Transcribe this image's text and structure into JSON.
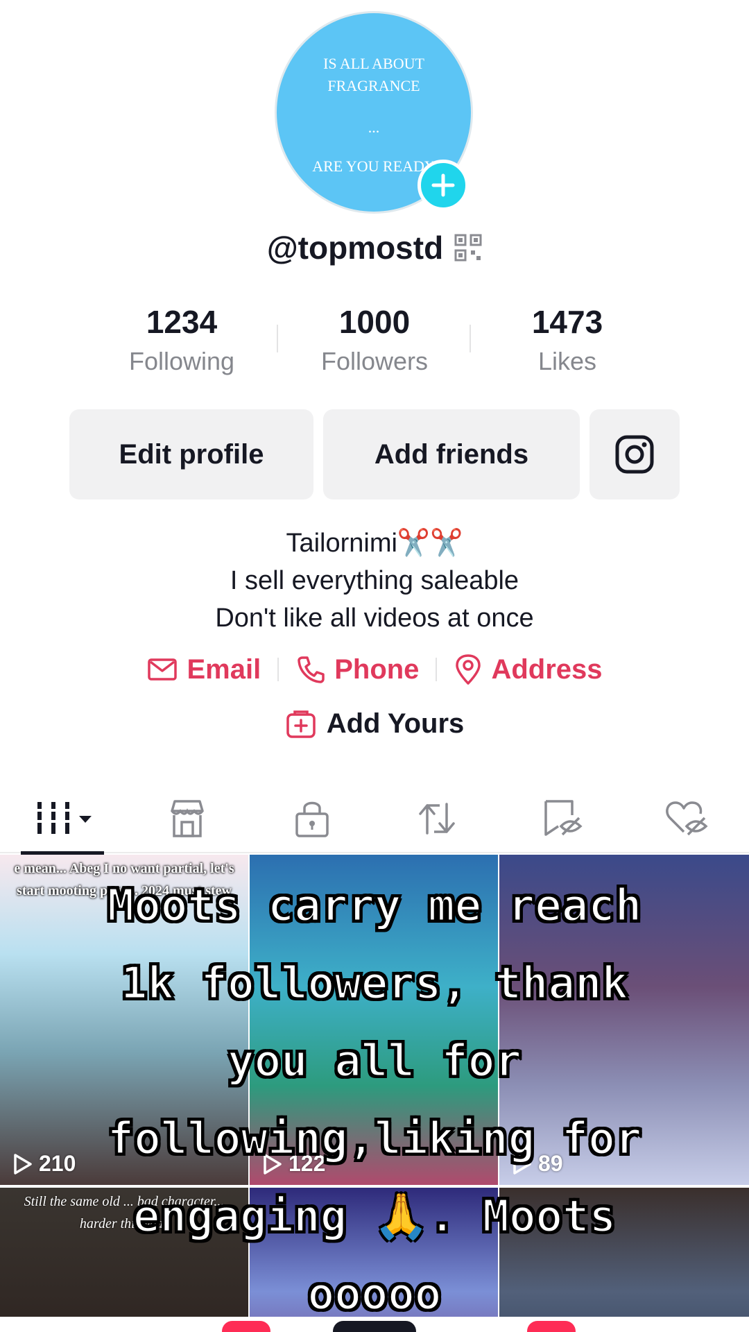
{
  "profile": {
    "avatar_lines": [
      "IS ALL ABOUT",
      "FRAGRANCE",
      "...",
      "ARE YOU READY"
    ],
    "username": "@topmostd",
    "stats": [
      {
        "value": "1234",
        "label": "Following"
      },
      {
        "value": "1000",
        "label": "Followers"
      },
      {
        "value": "1473",
        "label": "Likes"
      }
    ],
    "buttons": {
      "edit": "Edit profile",
      "add_friends": "Add friends"
    },
    "bio": [
      "Tailornimi✂️✂️",
      "I sell everything saleable",
      "Don't like all videos at once"
    ],
    "contacts": [
      {
        "label": "Email",
        "icon": "mail-icon"
      },
      {
        "label": "Phone",
        "icon": "phone-icon"
      },
      {
        "label": "Address",
        "icon": "location-pin-icon"
      }
    ],
    "add_yours": "Add Yours",
    "accent_color": "#e0395c"
  },
  "tabs": [
    {
      "name": "videos",
      "icon": "grid-bars-icon",
      "active": true
    },
    {
      "name": "shop",
      "icon": "shop-icon"
    },
    {
      "name": "private",
      "icon": "lock-icon"
    },
    {
      "name": "reposts",
      "icon": "repost-icon"
    },
    {
      "name": "favorites",
      "icon": "bookmark-hidden-icon"
    },
    {
      "name": "liked",
      "icon": "heart-hidden-icon"
    }
  ],
  "videos": [
    {
      "caption": "e mean... Abeg I no want partial, let's start mooting page... 2024 must stew",
      "views": "210"
    },
    {
      "caption": "",
      "views": "122"
    },
    {
      "caption": "",
      "views": "89"
    },
    {
      "caption": "Still the same old ... bad character... harder this year",
      "views": ""
    },
    {
      "caption": "",
      "views": ""
    },
    {
      "caption": "",
      "views": ""
    }
  ],
  "overlay_text": "Moots carry me reach 1k followers, thank you all for following,liking for engaging 🙏. Moots ooooo"
}
